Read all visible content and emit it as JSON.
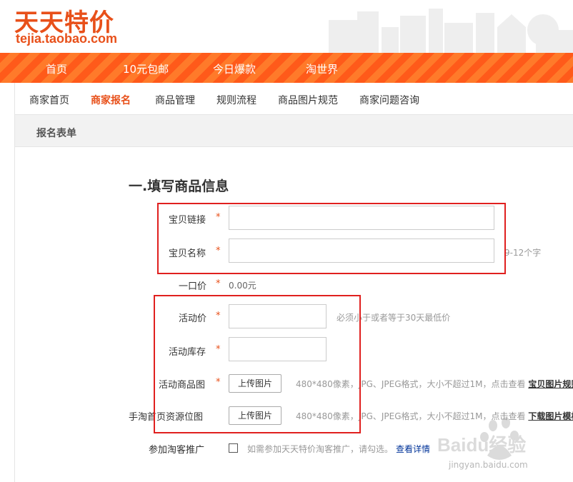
{
  "brand": {
    "logo_cn": "天天特价",
    "logo_en": "tejia.taobao.com",
    "color": "#e8501a"
  },
  "nav": [
    "首页",
    "10元包邮",
    "今日爆款",
    "淘世界"
  ],
  "subnav": [
    "商家首页",
    "商家报名",
    "商品管理",
    "规则流程",
    "商品图片规范",
    "商家问题咨询"
  ],
  "subnav_active_index": 1,
  "section": {
    "title": "报名表单"
  },
  "form": {
    "title": "一.填写商品信息",
    "required_mark": "*",
    "fields": {
      "item_link": {
        "label": "宝贝链接",
        "value": ""
      },
      "item_name": {
        "label": "宝贝名称",
        "value": "",
        "hint": "9-12个字"
      },
      "list_price": {
        "label": "一口价",
        "value": "0.00元"
      },
      "promo_price": {
        "label": "活动价",
        "value": "",
        "hint": "必须小于或者等于30天最低价"
      },
      "promo_stock": {
        "label": "活动库存",
        "value": ""
      },
      "promo_image": {
        "label": "活动商品图",
        "button": "上传图片",
        "hint": "480*480像素，JPG、JPEG格式，大小不超过1M，点击查看",
        "link": "宝贝图片规则"
      },
      "mobile_banner": {
        "label": "手淘首页资源位图",
        "button": "上传图片",
        "hint": "480*480像素，JPG、JPEG格式，大小不超过1M，点击查看",
        "link": "下载图片模板"
      },
      "taoke": {
        "label": "参加淘客推广",
        "checked": false,
        "hint": "如需参加天天特价淘客推广，请勾选。",
        "link": "查看详情"
      }
    }
  },
  "watermark": {
    "brand": "Baidu经验",
    "url": "jingyan.baidu.com"
  }
}
